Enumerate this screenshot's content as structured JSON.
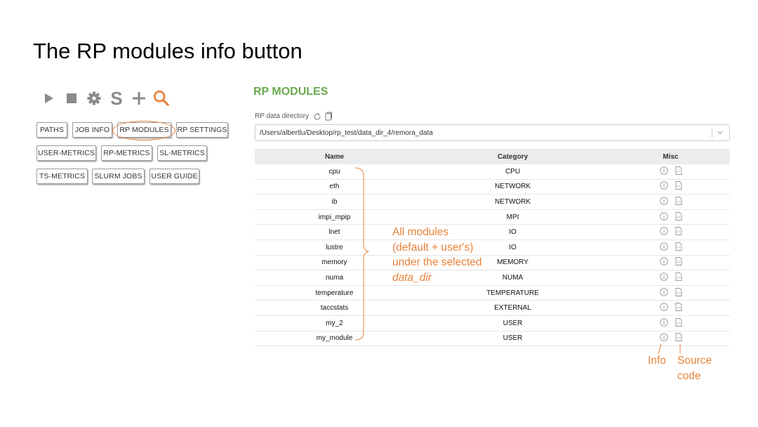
{
  "slide": {
    "title": "The RP modules info button"
  },
  "toolbar": {
    "s_glyph": "S"
  },
  "nav_buttons": {
    "paths": "PATHS",
    "job_info": "JOB INFO",
    "rp_modules": "RP MODULES",
    "rp_settings": "RP SETTINGS",
    "user_metrics": "USER-METRICS",
    "rp_metrics": "RP-METRICS",
    "sl_metrics": "SL-METRICS",
    "ts_metrics": "TS-METRICS",
    "slurm_jobs": "SLURM JOBS",
    "user_guide": "USER GUIDE"
  },
  "panel": {
    "title": "RP MODULES",
    "dir_label": "RP data directory",
    "dir_value": "/Users/albertlu/Desktop/rp_test/data_dir_4/remora_data"
  },
  "table": {
    "headers": {
      "name": "Name",
      "category": "Category",
      "misc": "Misc"
    },
    "rows": [
      {
        "name": "cpu",
        "category": "CPU"
      },
      {
        "name": "eth",
        "category": "NETWORK"
      },
      {
        "name": "ib",
        "category": "NETWORK"
      },
      {
        "name": "impi_mpip",
        "category": "MPI"
      },
      {
        "name": "lnet",
        "category": "IO"
      },
      {
        "name": "lustre",
        "category": "IO"
      },
      {
        "name": "memory",
        "category": "MEMORY"
      },
      {
        "name": "numa",
        "category": "NUMA"
      },
      {
        "name": "temperature",
        "category": "TEMPERATURE"
      },
      {
        "name": "taccstats",
        "category": "EXTERNAL"
      },
      {
        "name": "my_2",
        "category": "USER"
      },
      {
        "name": "my_module",
        "category": "USER"
      }
    ]
  },
  "annotations": {
    "line1": "All modules",
    "line2": "(default + user's)",
    "line3": "under the selected",
    "line4": "data_dir",
    "info": "Info",
    "source1": "Source",
    "source2": "code"
  },
  "colors": {
    "accent": "#e8833a",
    "panel_title": "#6aa84f",
    "toolbar_icon": "#8a8a8a"
  }
}
